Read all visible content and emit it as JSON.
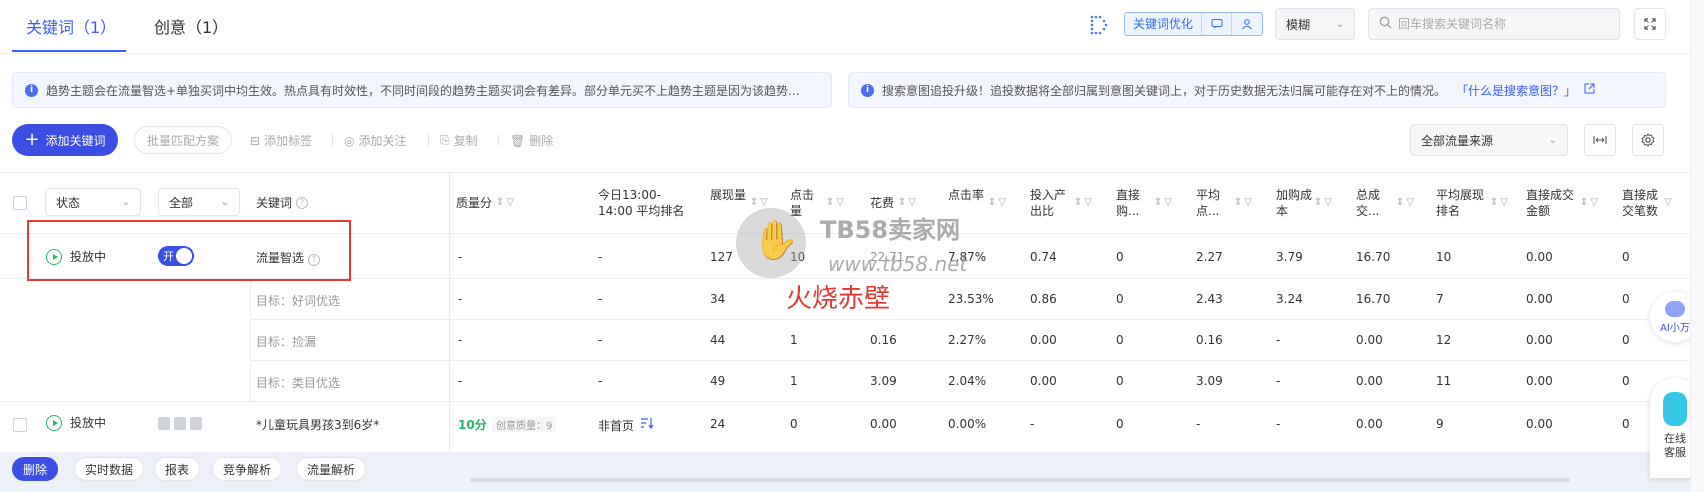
{
  "tabs": [
    {
      "label": "关键词（1）",
      "active": true
    },
    {
      "label": "创意（1）",
      "active": false
    }
  ],
  "header": {
    "optimize_label": "关键词优化",
    "match_select": "模糊",
    "search_placeholder": "回车搜索关键词名称"
  },
  "notices": {
    "left": "趋势主题会在流量智选+单独买词中均生效。热点具有时效性，不同时间段的趋势主题买词会有差异。部分单元买不上趋势主题是因为该趋势...",
    "right": "搜索意图追投升级！追投数据将全部归属到意图关键词上，对于历史数据无法归属可能存在对不上的情况。",
    "right_link": "「什么是搜索意图？」"
  },
  "toolbar": {
    "add_label": "添加关键词",
    "batch_label": "批量匹配方案",
    "tag_label": "添加标签",
    "follow_label": "添加关注",
    "copy_label": "复制",
    "delete_label": "删除",
    "source_select": "全部流量来源"
  },
  "table": {
    "filters": {
      "status": "状态",
      "all": "全部"
    },
    "columns": [
      "关键词",
      "质量分",
      "今日13:00-14:00 平均排名",
      "展现量",
      "点击量",
      "花费",
      "点击率",
      "投入产出比",
      "直接购...",
      "平均点...",
      "加购成本",
      "总成交...",
      "平均展现排名",
      "直接成交金额",
      "直接成交笔数"
    ],
    "rows": [
      {
        "status": "投放中",
        "toggle": "开",
        "keyword": "流量智选",
        "quality": "-",
        "rank": "-",
        "impressions": "127",
        "clicks": "10",
        "cost": "22.71",
        "ctr": "7.87%",
        "roi": "0.74",
        "direct_buy": "0",
        "avg_click": "2.27",
        "cart_cost": "3.79",
        "total_deal": "16.70",
        "avg_rank": "10",
        "deal_amount": "0.00",
        "deal_count": "0"
      },
      {
        "keyword": "目标：好词优选",
        "quality": "-",
        "rank": "-",
        "impressions": "34",
        "clicks": "",
        "cost": "",
        "ctr": "23.53%",
        "roi": "0.86",
        "direct_buy": "0",
        "avg_click": "2.43",
        "cart_cost": "3.24",
        "total_deal": "16.70",
        "avg_rank": "7",
        "deal_amount": "0.00",
        "deal_count": "0"
      },
      {
        "keyword": "目标：捡漏",
        "quality": "-",
        "rank": "-",
        "impressions": "44",
        "clicks": "1",
        "cost": "0.16",
        "ctr": "2.27%",
        "roi": "0.00",
        "direct_buy": "0",
        "avg_click": "0.16",
        "cart_cost": "-",
        "total_deal": "0.00",
        "avg_rank": "12",
        "deal_amount": "0.00",
        "deal_count": "0"
      },
      {
        "keyword": "目标：类目优选",
        "quality": "-",
        "rank": "-",
        "impressions": "49",
        "clicks": "1",
        "cost": "3.09",
        "ctr": "2.04%",
        "roi": "0.00",
        "direct_buy": "0",
        "avg_click": "3.09",
        "cart_cost": "-",
        "total_deal": "0.00",
        "avg_rank": "11",
        "deal_amount": "0.00",
        "deal_count": "0"
      },
      {
        "status": "投放中",
        "keyword": "*儿童玩具男孩3到6岁*",
        "quality_score": "10分",
        "creative_quality": "创意质量：9",
        "rank": "非首页",
        "impressions": "24",
        "clicks": "0",
        "cost": "0.00",
        "ctr": "0.00%",
        "roi": "-",
        "direct_buy": "0",
        "avg_click": "-",
        "cart_cost": "-",
        "total_deal": "0.00",
        "avg_rank": "9",
        "deal_amount": "0.00",
        "deal_count": "0"
      }
    ]
  },
  "bottom_actions": [
    "删除",
    "实时数据",
    "报表",
    "竞争解析",
    "流量解析"
  ],
  "watermark": {
    "brand": "TB58卖家网",
    "url": "www.tb58.net",
    "caption": "火烧赤壁"
  },
  "floating": {
    "ai_label": "AI小万",
    "service_label": "在线客服"
  },
  "colors": {
    "primary": "#3b4fe4",
    "success": "#25b864",
    "highlight": "#e53935"
  }
}
